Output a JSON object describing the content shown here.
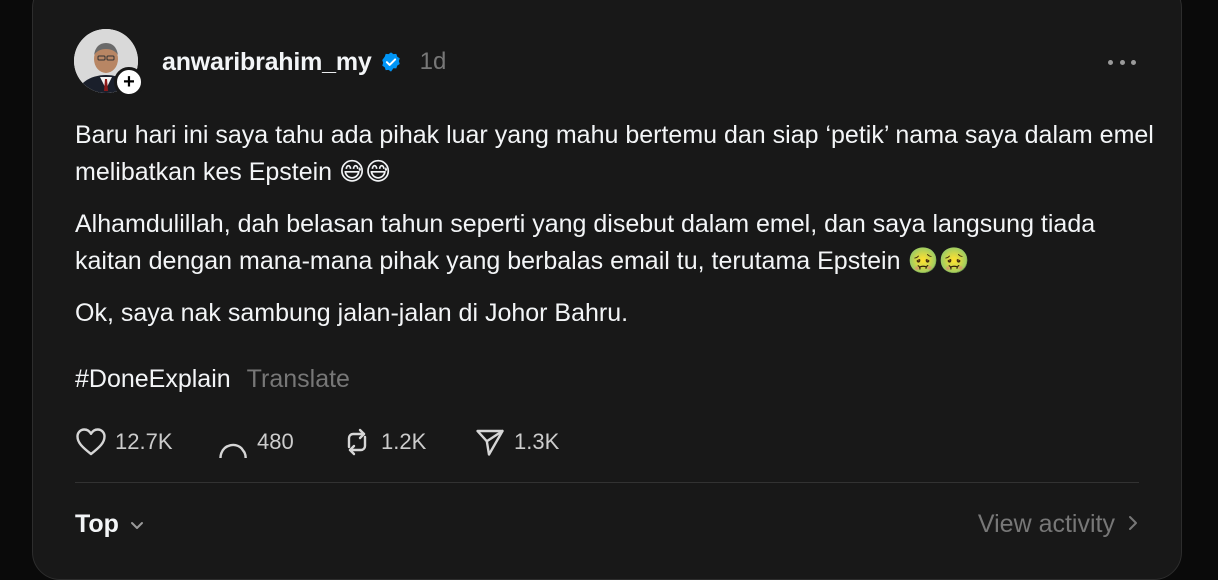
{
  "post": {
    "username": "anwaribrahim_my",
    "timestamp": "1d",
    "paragraphs": [
      "Baru hari ini saya tahu ada pihak luar yang mahu bertemu dan siap ‘petik’ nama saya dalam emel melibatkan kes Epstein 😅😅",
      "Alhamdulillah, dah belasan tahun seperti yang disebut dalam emel, dan saya langsung tiada kaitan dengan mana-mana pihak yang berbalas email tu, terutama Epstein 🤢🤢",
      "Ok, saya nak sambung jalan-jalan di Johor Bahru."
    ],
    "hashtag": "#DoneExplain",
    "translate_label": "Translate"
  },
  "actions": {
    "likes": "12.7K",
    "replies": "480",
    "reposts": "1.2K",
    "shares": "1.3K"
  },
  "footer": {
    "sort_label": "Top",
    "activity_label": "View activity"
  },
  "colors": {
    "background": "#0a0a0a",
    "card": "#181818",
    "verified": "#0095f6",
    "muted": "#777777"
  }
}
